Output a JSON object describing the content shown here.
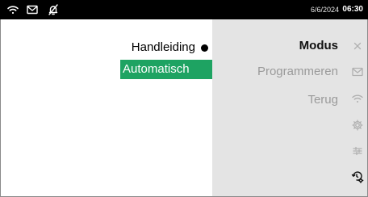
{
  "status_bar": {
    "date": "6/6/2024",
    "time": "06:30",
    "icons": [
      "wifi-icon",
      "mail-icon",
      "bell-off-icon"
    ]
  },
  "mode_options": {
    "manual": {
      "label": "Handleiding",
      "selected": true
    },
    "automatic": {
      "label": "Automatisch",
      "highlighted": true
    }
  },
  "menu": {
    "items": [
      {
        "label": "Modus",
        "active": true
      },
      {
        "label": "Programmeren",
        "active": false
      },
      {
        "label": "Terug",
        "active": false
      }
    ]
  },
  "side_icons": [
    "close-icon",
    "mail-icon",
    "wifi-icon",
    "gear-icon",
    "sliders-icon",
    "history-settings-icon"
  ],
  "colors": {
    "status_bar_bg": "#000000",
    "highlight": "#1ea362",
    "menu_bg": "#e4e4e4",
    "menu_disabled_text": "#9a9a9a"
  }
}
